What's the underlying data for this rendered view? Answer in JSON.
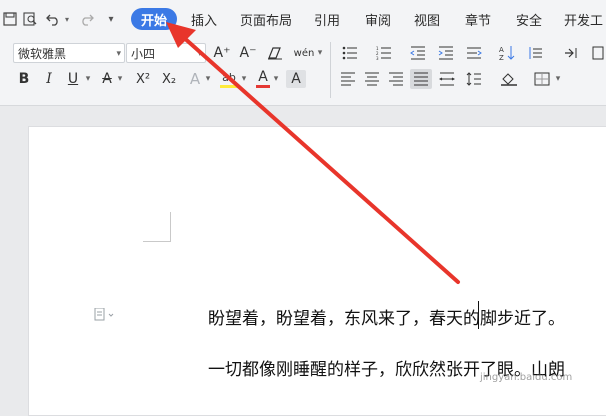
{
  "menubar": {
    "quick_access": [
      "save-icon",
      "print-preview-icon",
      "undo-icon",
      "redo-icon",
      "more-icon"
    ],
    "tabs": [
      {
        "label": "开始",
        "active": true
      },
      {
        "label": "插入"
      },
      {
        "label": "页面布局"
      },
      {
        "label": "引用"
      },
      {
        "label": "审阅"
      },
      {
        "label": "视图"
      },
      {
        "label": "章节"
      },
      {
        "label": "安全"
      },
      {
        "label": "开发工"
      }
    ]
  },
  "toolbar": {
    "font_name": "微软雅黑",
    "font_size": "小四",
    "bold": "B",
    "italic": "I",
    "underline": "U",
    "strike": "A",
    "superscript": "X²",
    "subscript": "X₂",
    "text_effect": "A",
    "highlight": "ab",
    "font_color": "A",
    "char_shade": "A",
    "grow_font": "A⁺",
    "shrink_font": "A⁻",
    "phonetic": "wén"
  },
  "document": {
    "lines": [
      "盼望着，盼望着，东风来了，春天的脚步近了。",
      "一切都像刚睡醒的样子，欣欣然张开了眼。山朗"
    ]
  },
  "watermark": "jingyan.baidu.com",
  "colors": {
    "accent": "#3b79e5",
    "arrow": "#e8352b",
    "font_color_bar": "#e53935",
    "highlight_bar": "#ffeb3b"
  }
}
